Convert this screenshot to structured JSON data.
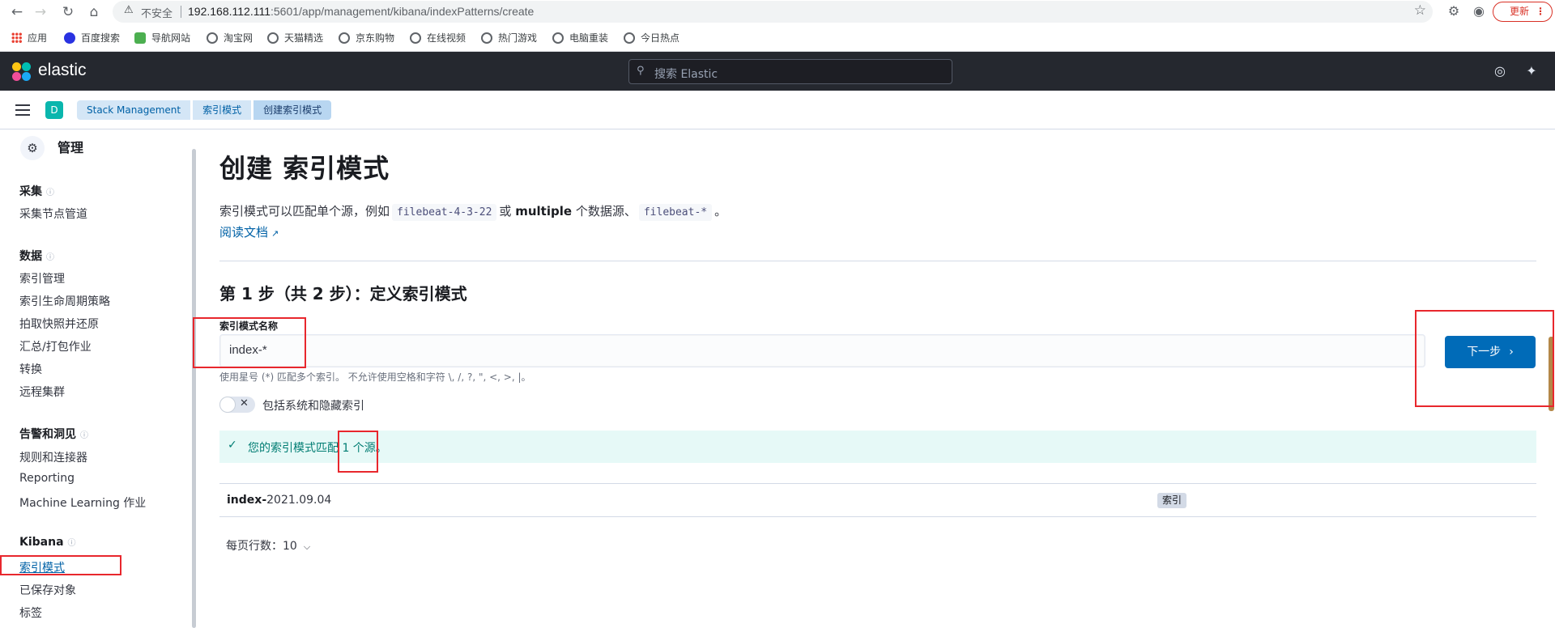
{
  "browser": {
    "insecure_label": "不安全",
    "url_host": "192.168.112.111",
    "url_rest": ":5601/app/management/kibana/indexPatterns/create",
    "update_label": "更新",
    "bookmarks": [
      "应用",
      "百度搜索",
      "导航网站",
      "淘宝网",
      "天猫精选",
      "京东购物",
      "在线视频",
      "热门游戏",
      "电脑重装",
      "今日热点"
    ]
  },
  "header": {
    "brand": "elastic",
    "search_placeholder": "搜索 Elastic"
  },
  "crumbbar": {
    "space_initial": "D",
    "breadcrumbs": [
      "Stack Management",
      "索引模式",
      "创建索引模式"
    ]
  },
  "sidebar": {
    "title": "管理",
    "groups": [
      {
        "label": "采集",
        "items": [
          "采集节点管道"
        ]
      },
      {
        "label": "数据",
        "items": [
          "索引管理",
          "索引生命周期策略",
          "拍取快照并还原",
          "汇总/打包作业",
          "转换",
          "远程集群"
        ]
      },
      {
        "label": "告警和洞见",
        "items": [
          "规则和连接器",
          "Reporting",
          "Machine Learning 作业"
        ]
      },
      {
        "label": "Kibana",
        "items": [
          "索引模式",
          "已保存对象",
          "标签"
        ]
      }
    ],
    "active_item": "索引模式"
  },
  "main": {
    "title": "创建 索引模式",
    "desc_prefix": "索引模式可以匹配单个源，例如",
    "desc_code1": "filebeat-4-3-22",
    "desc_or": "或",
    "desc_bold": "multiple",
    "desc_mid": "个数据源、",
    "desc_code2": "filebeat-*",
    "desc_end": "。",
    "doc_link": "阅读文档",
    "step_title": "第 1 步（共 2 步）：定义索引模式",
    "field_label": "索引模式名称",
    "field_value": "index-*",
    "help_text": "使用星号 (*) 匹配多个索引。 不允许使用空格和字符 \\, /, ?, \", <, >, |。",
    "next_label": "下一步",
    "toggle_label": "包括系统和隐藏索引",
    "callout_text": "您的索引模式匹配 1 个源。",
    "results": [
      {
        "name_bold": "index-",
        "name_rest": "2021.09.04",
        "badge": "索引"
      }
    ],
    "rows_per_page": "每页行数：10"
  }
}
